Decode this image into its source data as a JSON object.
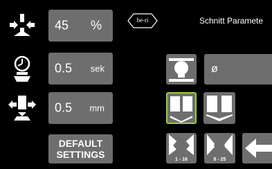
{
  "header": {
    "logo_text": "be-ri",
    "title": "Schnitt Paramete"
  },
  "params": [
    {
      "value": "45",
      "unit": "%",
      "icon": "compress-arrows-icon"
    },
    {
      "value": "0.5",
      "unit": "sek",
      "icon": "clock-press-icon"
    },
    {
      "value": "0.5",
      "unit": "mm",
      "icon": "spread-arrows-icon"
    }
  ],
  "default_button": {
    "line1": "DEFAULT",
    "line2": "SETTINGS"
  },
  "tool_field": {
    "value": "ø"
  },
  "size_buttons": [
    {
      "label": "1 - 16"
    },
    {
      "label": "8 - 25"
    }
  ],
  "colors": {
    "accent": "#9ccc3c",
    "panel": "#6e6e6e",
    "background": "#000000"
  }
}
